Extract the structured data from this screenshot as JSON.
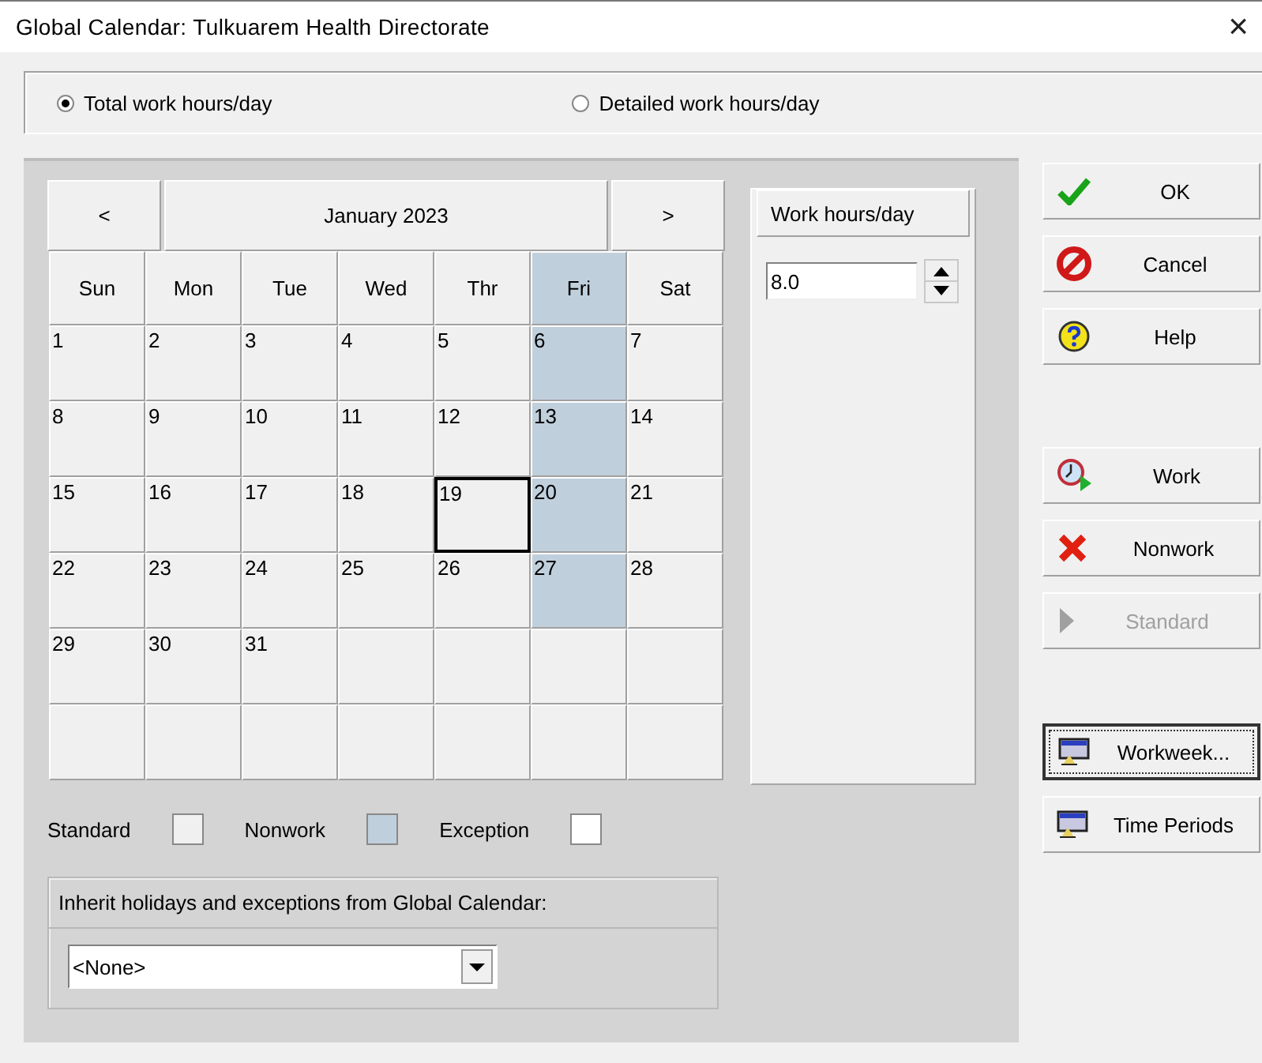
{
  "window": {
    "title": "Global Calendar: Tulkuarem Health Directorate",
    "close": "×"
  },
  "mode_options": [
    {
      "label": "Total work hours/day",
      "selected": true
    },
    {
      "label": "Detailed work hours/day",
      "selected": false
    }
  ],
  "calendar": {
    "prev": "<",
    "month": "January 2023",
    "next": ">",
    "weekdays": [
      {
        "label": "Sun",
        "nonwork": false
      },
      {
        "label": "Mon",
        "nonwork": false
      },
      {
        "label": "Tue",
        "nonwork": false
      },
      {
        "label": "Wed",
        "nonwork": false
      },
      {
        "label": "Thr",
        "nonwork": false
      },
      {
        "label": "Fri",
        "nonwork": true
      },
      {
        "label": "Sat",
        "nonwork": false
      }
    ],
    "cells": [
      {
        "kind": "day",
        "day": "1",
        "nonwork": false,
        "selected": false
      },
      {
        "kind": "day",
        "day": "2",
        "nonwork": false,
        "selected": false
      },
      {
        "kind": "day",
        "day": "3",
        "nonwork": false,
        "selected": false
      },
      {
        "kind": "day",
        "day": "4",
        "nonwork": false,
        "selected": false
      },
      {
        "kind": "day",
        "day": "5",
        "nonwork": false,
        "selected": false
      },
      {
        "kind": "day",
        "day": "6",
        "nonwork": true,
        "selected": false
      },
      {
        "kind": "day",
        "day": "7",
        "nonwork": false,
        "selected": false
      },
      {
        "kind": "day",
        "day": "8",
        "nonwork": false,
        "selected": false
      },
      {
        "kind": "day",
        "day": "9",
        "nonwork": false,
        "selected": false
      },
      {
        "kind": "day",
        "day": "10",
        "nonwork": false,
        "selected": false
      },
      {
        "kind": "day",
        "day": "11",
        "nonwork": false,
        "selected": false
      },
      {
        "kind": "day",
        "day": "12",
        "nonwork": false,
        "selected": false
      },
      {
        "kind": "day",
        "day": "13",
        "nonwork": true,
        "selected": false
      },
      {
        "kind": "day",
        "day": "14",
        "nonwork": false,
        "selected": false
      },
      {
        "kind": "day",
        "day": "15",
        "nonwork": false,
        "selected": false
      },
      {
        "kind": "day",
        "day": "16",
        "nonwork": false,
        "selected": false
      },
      {
        "kind": "day",
        "day": "17",
        "nonwork": false,
        "selected": false
      },
      {
        "kind": "day",
        "day": "18",
        "nonwork": false,
        "selected": false
      },
      {
        "kind": "day",
        "day": "19",
        "nonwork": false,
        "selected": true
      },
      {
        "kind": "day",
        "day": "20",
        "nonwork": true,
        "selected": false
      },
      {
        "kind": "day",
        "day": "21",
        "nonwork": false,
        "selected": false
      },
      {
        "kind": "day",
        "day": "22",
        "nonwork": false,
        "selected": false
      },
      {
        "kind": "day",
        "day": "23",
        "nonwork": false,
        "selected": false
      },
      {
        "kind": "day",
        "day": "24",
        "nonwork": false,
        "selected": false
      },
      {
        "kind": "day",
        "day": "25",
        "nonwork": false,
        "selected": false
      },
      {
        "kind": "day",
        "day": "26",
        "nonwork": false,
        "selected": false
      },
      {
        "kind": "day",
        "day": "27",
        "nonwork": true,
        "selected": false
      },
      {
        "kind": "day",
        "day": "28",
        "nonwork": false,
        "selected": false
      },
      {
        "kind": "day",
        "day": "29",
        "nonwork": false,
        "selected": false
      },
      {
        "kind": "day",
        "day": "30",
        "nonwork": false,
        "selected": false
      },
      {
        "kind": "day",
        "day": "31",
        "nonwork": false,
        "selected": false
      },
      {
        "kind": "blank"
      },
      {
        "kind": "blank"
      },
      {
        "kind": "blank"
      },
      {
        "kind": "blank"
      },
      {
        "kind": "blank"
      },
      {
        "kind": "blank"
      },
      {
        "kind": "blank"
      },
      {
        "kind": "blank"
      },
      {
        "kind": "blank"
      },
      {
        "kind": "blank"
      },
      {
        "kind": "blank"
      }
    ]
  },
  "work_hours": {
    "heading": "Work hours/day",
    "value": "8.0"
  },
  "legend": [
    {
      "label": "Standard",
      "color": "#f0f0f0"
    },
    {
      "label": "Nonwork",
      "color": "#c0cfdc"
    },
    {
      "label": "Exception",
      "color": "#ffffff"
    }
  ],
  "inherit": {
    "label": "Inherit holidays and exceptions from Global Calendar:",
    "value": "<None>"
  },
  "button_groups": [
    [
      {
        "label": "OK",
        "disabled": false,
        "focused": false
      },
      {
        "label": "Cancel",
        "disabled": false,
        "focused": false
      },
      {
        "label": "Help",
        "disabled": false,
        "focused": false
      }
    ],
    [
      {
        "label": "Work",
        "disabled": false,
        "focused": false
      },
      {
        "label": "Nonwork",
        "disabled": false,
        "focused": false
      },
      {
        "label": "Standard",
        "disabled": true,
        "focused": false
      }
    ],
    [
      {
        "label": "Workweek...",
        "disabled": false,
        "focused": true
      },
      {
        "label": "Time Periods",
        "disabled": false,
        "focused": false
      }
    ]
  ]
}
